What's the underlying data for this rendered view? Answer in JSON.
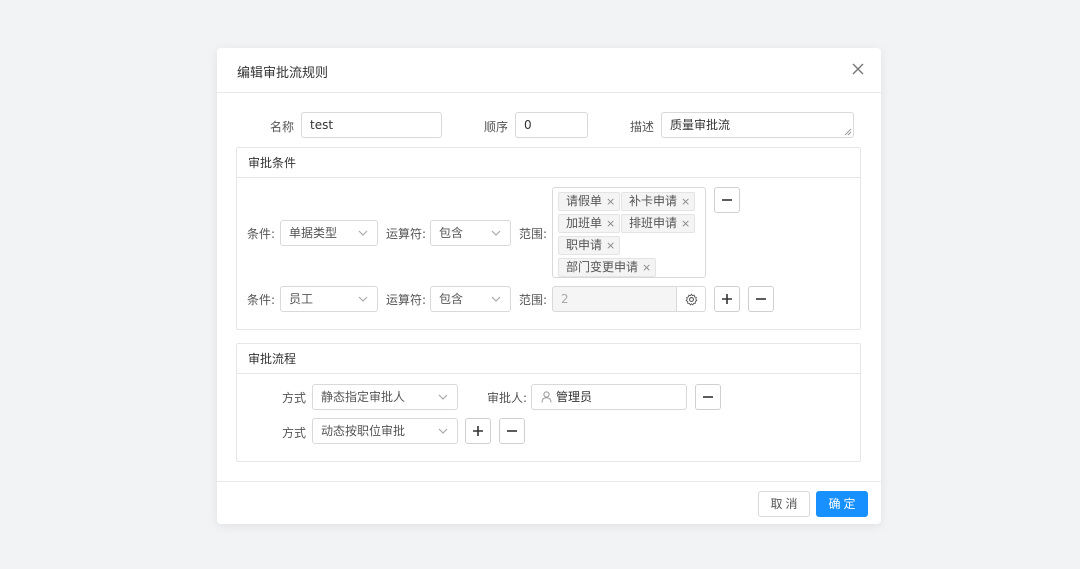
{
  "dialog": {
    "title": "编辑审批流规则",
    "close_icon": "close-icon"
  },
  "basic": {
    "name_label": "名称",
    "name_value": "test",
    "order_label": "顺序",
    "order_value": "0",
    "desc_label": "描述",
    "desc_value": "质量审批流"
  },
  "conditions": {
    "title": "审批条件",
    "rows": [
      {
        "cond_label": "条件:",
        "cond_value": "单据类型",
        "op_label": "运算符:",
        "op_value": "包含",
        "range_label": "范围:",
        "tags": [
          "请假单",
          "补卡申请",
          "加班单",
          "排班申请",
          "职申请",
          "部门变更申请"
        ]
      },
      {
        "cond_label": "条件:",
        "cond_value": "员工",
        "op_label": "运算符:",
        "op_value": "包含",
        "range_label": "范围:",
        "range_value": "2"
      }
    ]
  },
  "flow": {
    "title": "审批流程",
    "rows": [
      {
        "mode_label": "方式",
        "mode_value": "静态指定审批人",
        "approver_label": "审批人:",
        "approver_value": "管理员"
      },
      {
        "mode_label": "方式",
        "mode_value": "动态按职位审批"
      }
    ]
  },
  "footer": {
    "cancel_label": "取消",
    "ok_label": "确定"
  },
  "colors": {
    "primary": "#1890ff",
    "border": "#d9d9d9",
    "background": "#f2f3f5"
  }
}
